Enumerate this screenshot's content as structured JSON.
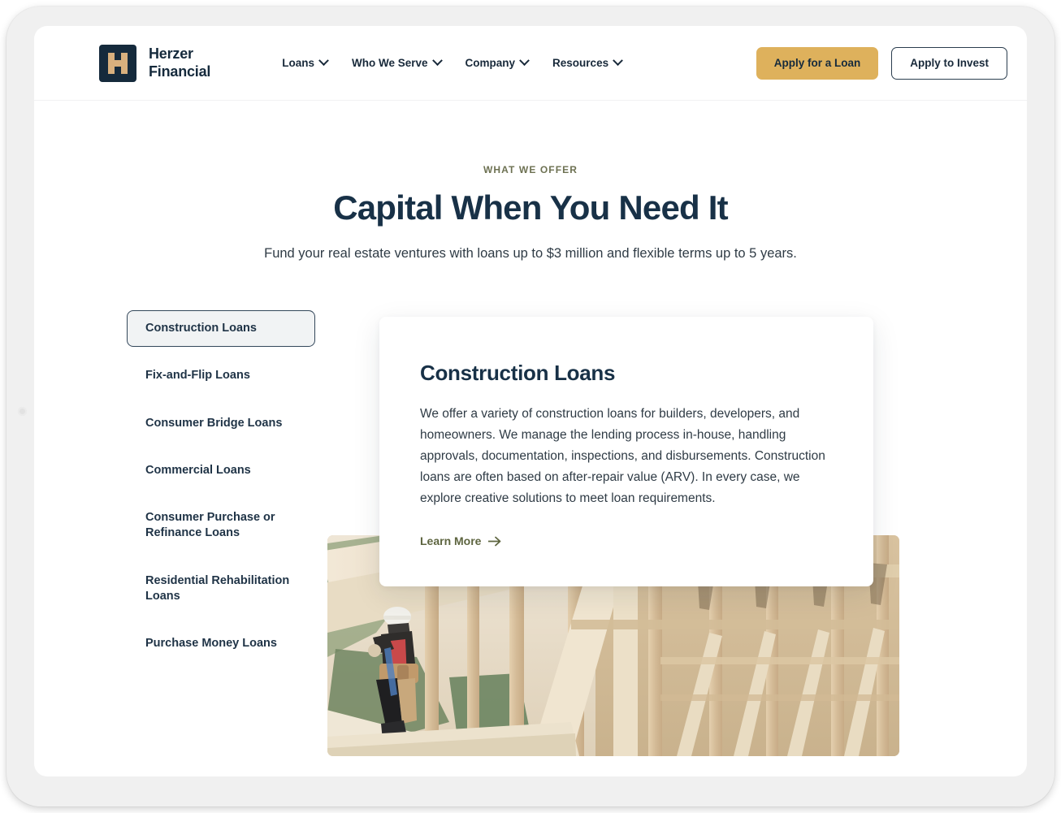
{
  "brand": {
    "logo_icon": "herzer-h-logo-icon",
    "name_line1": "Herzer",
    "name_line2": "Financial"
  },
  "nav": {
    "items": [
      {
        "label": "Loans",
        "icon": "chevron-down-icon"
      },
      {
        "label": "Who We Serve",
        "icon": "chevron-down-icon"
      },
      {
        "label": "Company",
        "icon": "chevron-down-icon"
      },
      {
        "label": "Resources",
        "icon": "chevron-down-icon"
      }
    ]
  },
  "header_actions": {
    "primary_label": "Apply for a Loan",
    "secondary_label": "Apply to Invest"
  },
  "hero": {
    "eyebrow": "WHAT WE OFFER",
    "title": "Capital When You Need It",
    "subtitle": "Fund your real estate ventures with loans up to $3 million and flexible terms up to 5 years."
  },
  "offerings": {
    "tabs": [
      {
        "label": "Construction Loans",
        "active": true
      },
      {
        "label": "Fix-and-Flip Loans",
        "active": false
      },
      {
        "label": "Consumer Bridge Loans",
        "active": false
      },
      {
        "label": "Commercial Loans",
        "active": false
      },
      {
        "label": "Consumer Purchase or Refinance Loans",
        "active": false
      },
      {
        "label": "Residential Rehabilitation Loans",
        "active": false
      },
      {
        "label": "Purchase Money Loans",
        "active": false
      }
    ],
    "panel": {
      "title": "Construction Loans",
      "body": "We offer a variety of construction loans for builders, developers, and homeowners. We manage the lending process in-house, handling approvals, documentation, inspections, and disbursements. Construction loans are often based on after-repair value (ARV). In every case, we explore creative solutions to meet loan requirements.",
      "link_label": "Learn More",
      "link_icon": "arrow-right-icon"
    },
    "photo_alt": "Construction worker in hard hat standing on wood roof framing of a house under construction"
  },
  "colors": {
    "navy": "#183147",
    "gold": "#deb15c",
    "olive": "#6d7152",
    "logo_tan": "#d8b07e",
    "tab_active_bg": "#f1f3f4",
    "device_bezel": "#f0f0f0"
  }
}
